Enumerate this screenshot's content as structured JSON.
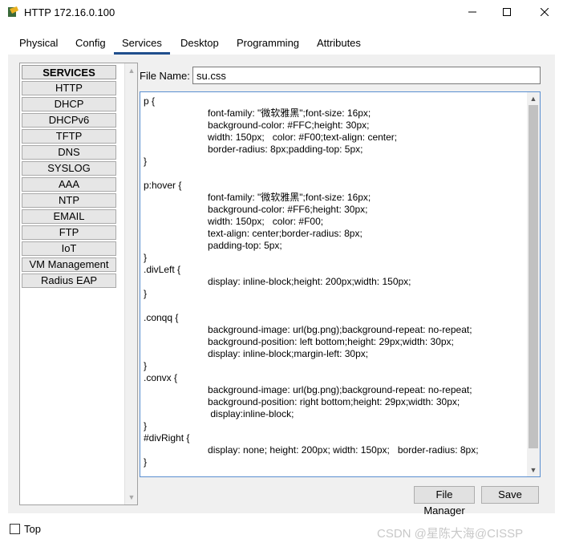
{
  "window": {
    "title": "HTTP 172.16.0.100",
    "icons": {
      "app": "packet-tracer-icon",
      "minimize": "minimize-icon",
      "maximize": "maximize-icon",
      "close": "close-icon"
    }
  },
  "tabs": [
    {
      "label": "Physical"
    },
    {
      "label": "Config"
    },
    {
      "label": "Services",
      "active": true
    },
    {
      "label": "Desktop"
    },
    {
      "label": "Programming"
    },
    {
      "label": "Attributes"
    }
  ],
  "sidebar": {
    "header": "SERVICES",
    "items": [
      {
        "label": "HTTP"
      },
      {
        "label": "DHCP"
      },
      {
        "label": "DHCPv6"
      },
      {
        "label": "TFTP"
      },
      {
        "label": "DNS"
      },
      {
        "label": "SYSLOG"
      },
      {
        "label": "AAA"
      },
      {
        "label": "NTP"
      },
      {
        "label": "EMAIL"
      },
      {
        "label": "FTP"
      },
      {
        "label": "IoT"
      },
      {
        "label": "VM Management"
      },
      {
        "label": "Radius EAP"
      }
    ]
  },
  "editor": {
    "file_name_label": "File Name:",
    "file_name": "su.css",
    "content": "p {\n\t\t\tfont-family: \"微软雅黑\";font-size: 16px;\n\t\t\tbackground-color: #FFC;height: 30px;\n\t\t\twidth: 150px;   color: #F00;text-align: center;\n\t\t\tborder-radius: 8px;padding-top: 5px;\n}\n\np:hover {\n\t\t\tfont-family: \"微软雅黑\";font-size: 16px;\n\t\t\tbackground-color: #FF6;height: 30px;\n\t\t\twidth: 150px;   color: #F00;\n\t\t\ttext-align: center;border-radius: 8px;\n\t\t\tpadding-top: 5px;\n}\n.divLeft {\n\t\t\tdisplay: inline-block;height: 200px;width: 150px;\n}\n\n.conqq {\n\t\t\tbackground-image: url(bg.png);background-repeat: no-repeat;\n\t\t\tbackground-position: left bottom;height: 29px;width: 30px;\n\t\t\tdisplay: inline-block;margin-left: 30px;\n}\n.convx {\n\t\t\tbackground-image: url(bg.png);background-repeat: no-repeat;\n\t\t\tbackground-position: right bottom;height: 29px;width: 30px;\n\t\t\t display:inline-block;\n}\n#divRight {\n\t\t\tdisplay: none; height: 200px; width: 150px;   border-radius: 8px;\n}"
  },
  "buttons": {
    "file_manager": "File Manager",
    "save": "Save"
  },
  "footer": {
    "top_label": "Top",
    "top_checked": false,
    "watermark": "CSDN @星陈大海@CISSP"
  },
  "colors": {
    "active_tab_underline": "#1f4e8c",
    "editor_border": "#5a8fd0",
    "panel_bg": "#f0f0f0"
  }
}
